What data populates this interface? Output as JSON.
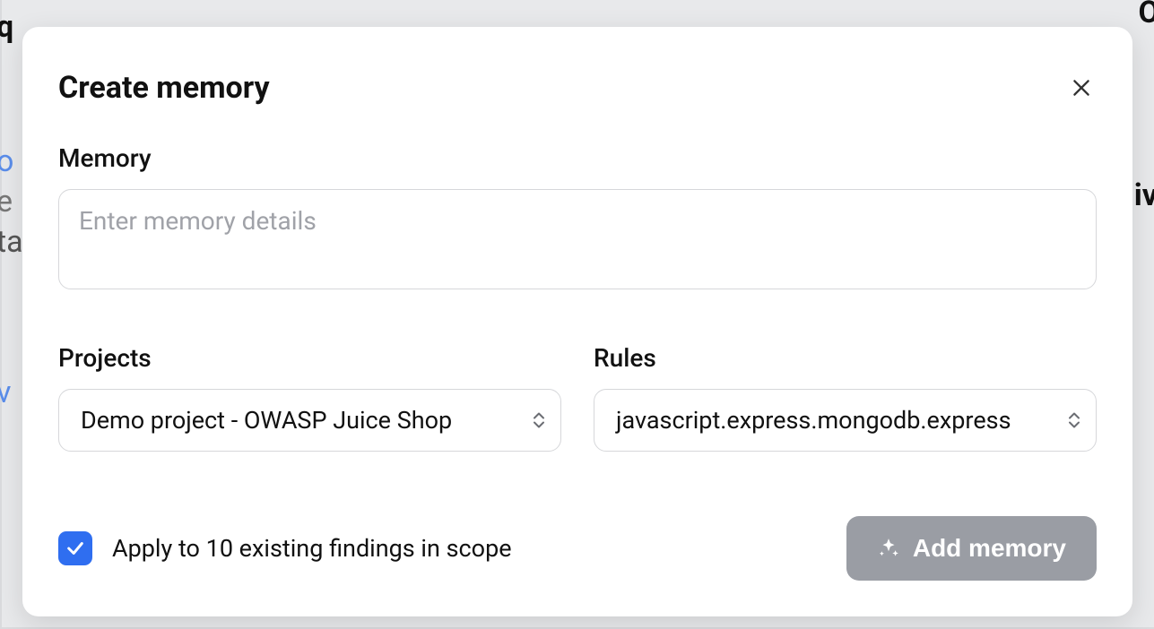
{
  "modal": {
    "title": "Create memory",
    "memory": {
      "label": "Memory",
      "value": "",
      "placeholder": "Enter memory details"
    },
    "projects": {
      "label": "Projects",
      "selected": "Demo project - OWASP Juice Shop"
    },
    "rules": {
      "label": "Rules",
      "selected": "javascript.express.mongodb.express"
    },
    "apply": {
      "checked": true,
      "label": "Apply to 10 existing findings in scope"
    },
    "submit_label": "Add memory"
  },
  "colors": {
    "primary": "#2f6ef0",
    "button_disabled": "#9a9da4",
    "border": "#d6d7da"
  }
}
